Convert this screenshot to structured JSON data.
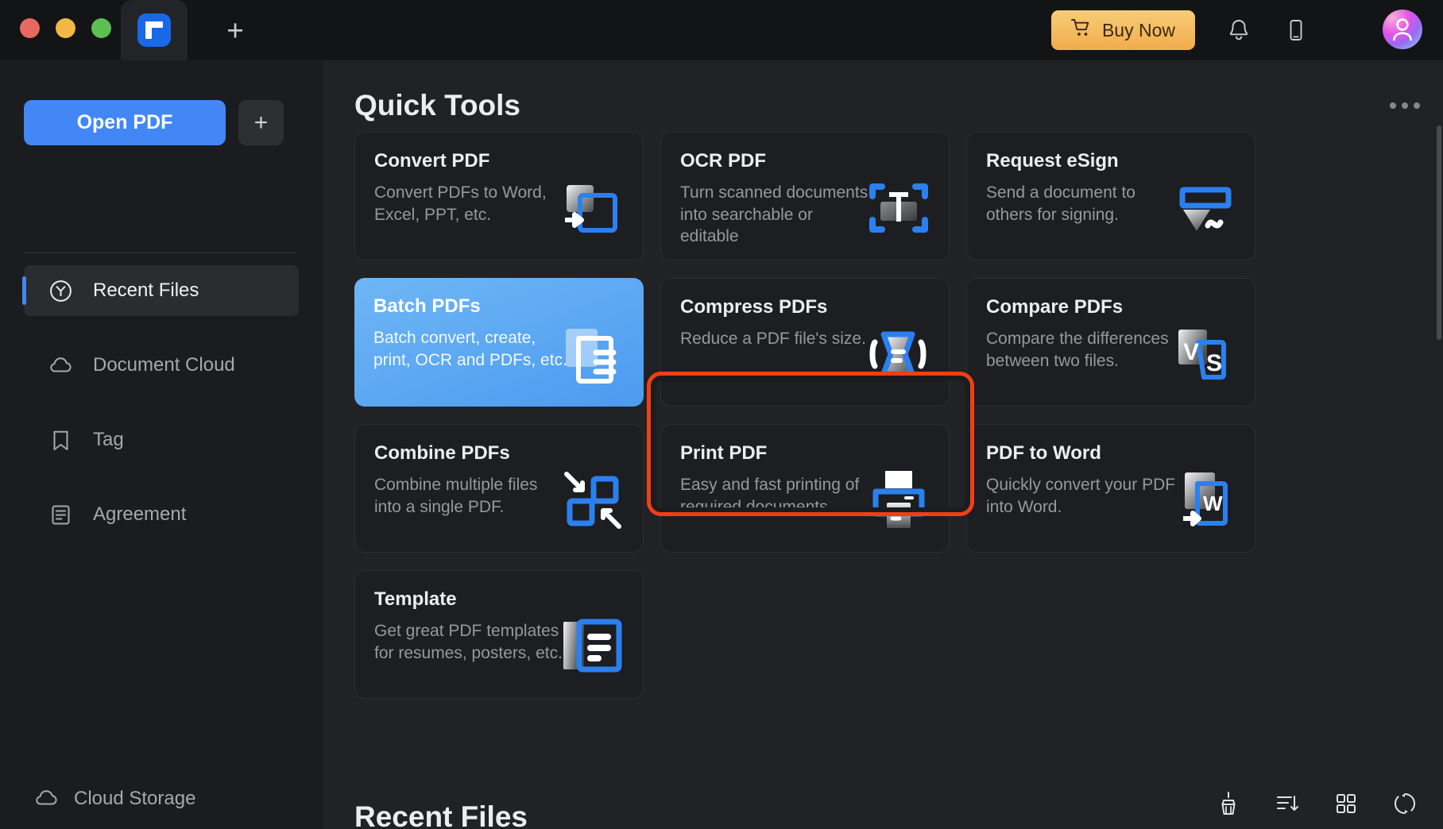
{
  "titlebar": {
    "window_controls": [
      "close",
      "minimize",
      "maximize"
    ],
    "tab_logo": "pdfelement-logo-icon",
    "new_tab_label": "+",
    "buy_now_label": "Buy Now",
    "cart_icon": "cart-icon",
    "bell_icon": "bell-icon",
    "phone_icon": "mobile-phone-icon",
    "avatar_icon": "user-avatar"
  },
  "sidebar": {
    "open_pdf_label": "Open PDF",
    "add_label": "+",
    "items": [
      {
        "label": "Recent Files",
        "icon": "recent-clock-icon",
        "active": true
      },
      {
        "label": "Document Cloud",
        "icon": "cloud-icon",
        "active": false
      },
      {
        "label": "Tag",
        "icon": "bookmark-icon",
        "active": false
      },
      {
        "label": "Agreement",
        "icon": "agreement-document-icon",
        "active": false
      }
    ],
    "cloud_storage_label": "Cloud Storage",
    "cloud_storage_icon": "cloud-icon"
  },
  "main": {
    "title": "Quick Tools",
    "more_label": "…",
    "recent_files_title": "Recent Files",
    "cards": [
      {
        "title": "Convert PDF",
        "desc": "Convert PDFs to Word, Excel, PPT, etc.",
        "icon": "convert-pdf-icon",
        "highlighted": false
      },
      {
        "title": "OCR PDF",
        "desc": "Turn scanned documents into searchable or editable",
        "icon": "ocr-scan-icon",
        "highlighted": false
      },
      {
        "title": "Request eSign",
        "desc": "Send a document to others for signing.",
        "icon": "esign-icon",
        "highlighted": false
      },
      {
        "title": "Batch PDFs",
        "desc": "Batch convert, create, print, OCR and PDFs, etc.",
        "icon": "batch-pdfs-icon",
        "highlighted": true
      },
      {
        "title": "Compress PDFs",
        "desc": "Reduce a PDF file's size.",
        "icon": "compress-icon",
        "highlighted": false
      },
      {
        "title": "Compare PDFs",
        "desc": "Compare the differences between two files.",
        "icon": "compare-vs-icon",
        "highlighted": false
      },
      {
        "title": "Combine PDFs",
        "desc": "Combine multiple files into a single PDF.",
        "icon": "combine-icon",
        "highlighted": false
      },
      {
        "title": "Print PDF",
        "desc": "Easy and fast printing of required documents.",
        "icon": "printer-icon",
        "highlighted": false
      },
      {
        "title": "PDF to Word",
        "desc": "Quickly convert your PDF into Word.",
        "icon": "pdf-to-word-icon",
        "highlighted": false
      },
      {
        "title": "Template",
        "desc": "Get great PDF templates for resumes, posters, etc.",
        "icon": "template-icon",
        "highlighted": false
      }
    ],
    "bottom_icons": [
      "broom-clear-icon",
      "sort-descending-icon",
      "grid-view-icon",
      "refresh-icon"
    ]
  },
  "colors": {
    "accent_blue": "#4287f5",
    "highlight_red": "#f23e16",
    "buy_now_gold": "#f2ab4d",
    "card_bg": "#1d1e21",
    "main_bg": "#212225",
    "sidebar_bg": "#1b1c1f"
  }
}
